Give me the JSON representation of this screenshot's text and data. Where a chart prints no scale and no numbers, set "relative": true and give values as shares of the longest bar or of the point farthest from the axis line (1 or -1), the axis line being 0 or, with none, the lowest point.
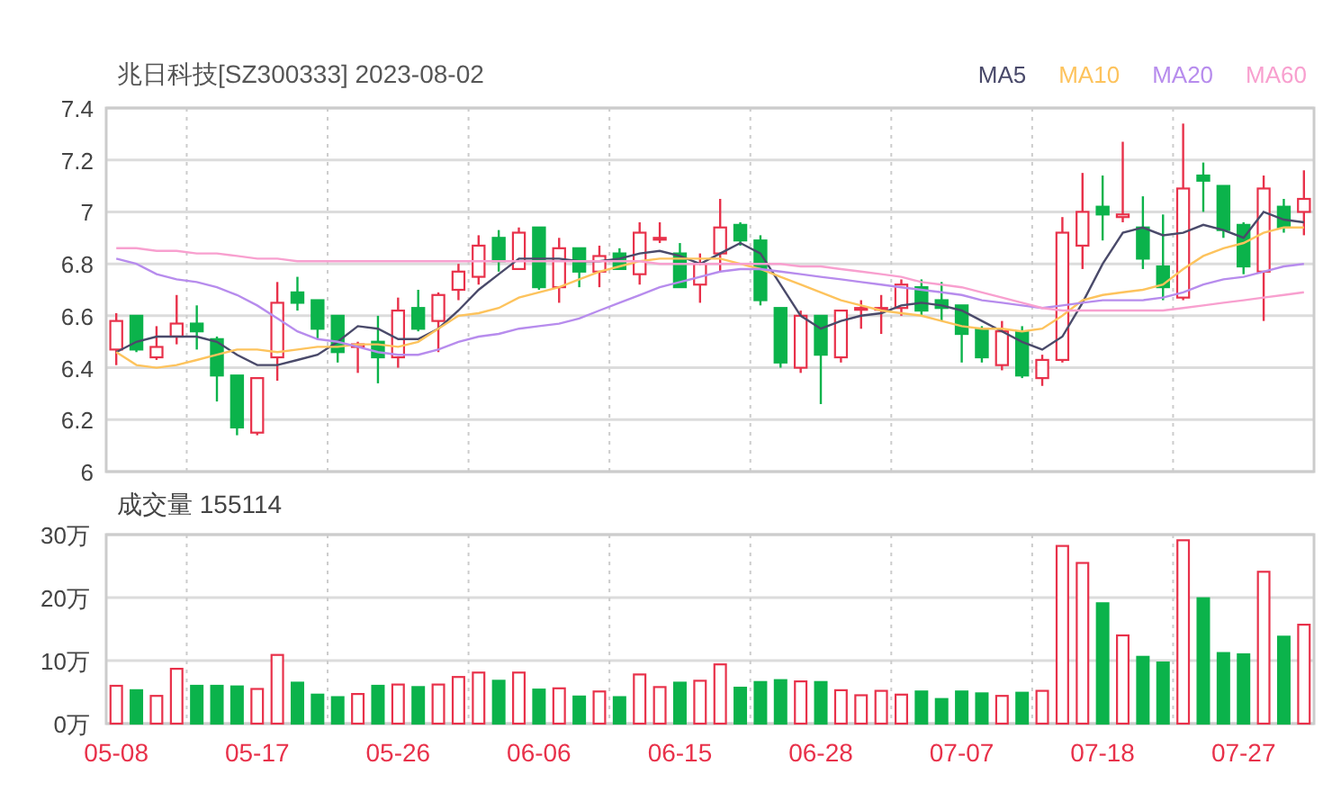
{
  "title": "兆日科技[SZ300333] 2023-08-02",
  "price_chart": {
    "chart_data": {
      "type": "candlestick",
      "grid": true,
      "ylim": [
        6,
        7.4
      ],
      "yticks": [
        6,
        6.2,
        6.4,
        6.6,
        6.8,
        7,
        7.2,
        7.4
      ],
      "ohlc": [
        [
          6.47,
          6.61,
          6.41,
          6.58
        ],
        [
          6.6,
          6.6,
          6.46,
          6.47
        ],
        [
          6.44,
          6.56,
          6.43,
          6.48
        ],
        [
          6.52,
          6.68,
          6.49,
          6.57
        ],
        [
          6.57,
          6.64,
          6.47,
          6.54
        ],
        [
          6.51,
          6.52,
          6.27,
          6.37
        ],
        [
          6.37,
          6.37,
          6.14,
          6.17
        ],
        [
          6.15,
          6.36,
          6.14,
          6.36
        ],
        [
          6.44,
          6.73,
          6.35,
          6.65
        ],
        [
          6.69,
          6.75,
          6.62,
          6.65
        ],
        [
          6.66,
          6.66,
          6.51,
          6.55
        ],
        [
          6.6,
          6.6,
          6.42,
          6.46
        ],
        [
          6.48,
          6.5,
          6.38,
          6.49
        ],
        [
          6.5,
          6.6,
          6.34,
          6.44
        ],
        [
          6.44,
          6.67,
          6.4,
          6.62
        ],
        [
          6.63,
          6.7,
          6.54,
          6.55
        ],
        [
          6.58,
          6.69,
          6.46,
          6.68
        ],
        [
          6.7,
          6.8,
          6.66,
          6.77
        ],
        [
          6.75,
          6.91,
          6.72,
          6.87
        ],
        [
          6.9,
          6.93,
          6.77,
          6.81
        ],
        [
          6.78,
          6.94,
          6.78,
          6.92
        ],
        [
          6.94,
          6.94,
          6.7,
          6.71
        ],
        [
          6.71,
          6.9,
          6.65,
          6.86
        ],
        [
          6.86,
          6.86,
          6.71,
          6.77
        ],
        [
          6.77,
          6.87,
          6.71,
          6.83
        ],
        [
          6.84,
          6.86,
          6.78,
          6.78
        ],
        [
          6.76,
          6.96,
          6.72,
          6.92
        ],
        [
          6.9,
          6.96,
          6.88,
          6.9
        ],
        [
          6.84,
          6.88,
          6.71,
          6.71
        ],
        [
          6.72,
          6.84,
          6.65,
          6.8
        ],
        [
          6.84,
          7.05,
          6.77,
          6.94
        ],
        [
          6.95,
          6.96,
          6.87,
          6.89
        ],
        [
          6.89,
          6.91,
          6.64,
          6.66
        ],
        [
          6.63,
          6.63,
          6.4,
          6.42
        ],
        [
          6.4,
          6.62,
          6.38,
          6.6
        ],
        [
          6.6,
          6.6,
          6.26,
          6.45
        ],
        [
          6.44,
          6.62,
          6.42,
          6.62
        ],
        [
          6.63,
          6.66,
          6.55,
          6.63
        ],
        [
          6.63,
          6.68,
          6.53,
          6.63
        ],
        [
          6.63,
          6.74,
          6.6,
          6.72
        ],
        [
          6.71,
          6.74,
          6.6,
          6.62
        ],
        [
          6.66,
          6.73,
          6.58,
          6.63
        ],
        [
          6.64,
          6.64,
          6.42,
          6.53
        ],
        [
          6.55,
          6.56,
          6.42,
          6.44
        ],
        [
          6.41,
          6.58,
          6.39,
          6.54
        ],
        [
          6.54,
          6.56,
          6.36,
          6.37
        ],
        [
          6.36,
          6.45,
          6.33,
          6.43
        ],
        [
          6.43,
          6.98,
          6.42,
          6.92
        ],
        [
          6.87,
          7.15,
          6.78,
          7.0
        ],
        [
          7.02,
          7.14,
          6.89,
          6.99
        ],
        [
          6.98,
          7.27,
          6.96,
          6.99
        ],
        [
          6.94,
          7.06,
          6.78,
          6.82
        ],
        [
          6.79,
          6.99,
          6.66,
          6.71
        ],
        [
          6.67,
          7.34,
          6.66,
          7.09
        ],
        [
          7.14,
          7.19,
          7.0,
          7.12
        ],
        [
          7.1,
          7.1,
          6.9,
          6.93
        ],
        [
          6.95,
          6.96,
          6.76,
          6.79
        ],
        [
          6.77,
          7.14,
          6.58,
          7.09
        ],
        [
          7.02,
          7.05,
          6.92,
          6.94
        ],
        [
          7.0,
          7.16,
          6.91,
          7.05
        ]
      ]
    },
    "moving_averages": {
      "chart_data": {
        "type": "line",
        "relative": true,
        "ylim": [
          6,
          7.4
        ],
        "series": [
          {
            "name": "MA5",
            "color": "#4a4a6a",
            "values": [
              6.46,
              6.5,
              6.52,
              6.52,
              6.52,
              6.5,
              6.45,
              6.41,
              6.41,
              6.43,
              6.45,
              6.5,
              6.56,
              6.55,
              6.51,
              6.51,
              6.55,
              6.62,
              6.7,
              6.76,
              6.82,
              6.82,
              6.82,
              6.81,
              6.81,
              6.82,
              6.84,
              6.85,
              6.83,
              6.8,
              6.84,
              6.88,
              6.84,
              6.72,
              6.6,
              6.55,
              6.58,
              6.6,
              6.61,
              6.64,
              6.65,
              6.64,
              6.62,
              6.58,
              6.54,
              6.5,
              6.47,
              6.52,
              6.65,
              6.8,
              6.92,
              6.94,
              6.91,
              6.92,
              6.95,
              6.93,
              6.9,
              7.0,
              6.97,
              6.96
            ]
          },
          {
            "name": "MA10",
            "color": "#fdc35d",
            "values": [
              6.46,
              6.41,
              6.4,
              6.41,
              6.43,
              6.45,
              6.47,
              6.47,
              6.46,
              6.47,
              6.48,
              6.48,
              6.49,
              6.49,
              6.48,
              6.5,
              6.55,
              6.6,
              6.61,
              6.63,
              6.67,
              6.69,
              6.71,
              6.74,
              6.77,
              6.79,
              6.81,
              6.82,
              6.82,
              6.82,
              6.82,
              6.8,
              6.78,
              6.75,
              6.72,
              6.69,
              6.66,
              6.64,
              6.62,
              6.61,
              6.6,
              6.58,
              6.56,
              6.55,
              6.55,
              6.54,
              6.55,
              6.6,
              6.66,
              6.68,
              6.69,
              6.7,
              6.72,
              6.78,
              6.83,
              6.86,
              6.88,
              6.92,
              6.94,
              6.94
            ]
          },
          {
            "name": "MA20",
            "color": "#b78ced",
            "values": [
              6.82,
              6.8,
              6.76,
              6.74,
              6.73,
              6.71,
              6.68,
              6.64,
              6.59,
              6.54,
              6.51,
              6.5,
              6.48,
              6.46,
              6.45,
              6.45,
              6.47,
              6.5,
              6.52,
              6.53,
              6.55,
              6.56,
              6.57,
              6.59,
              6.62,
              6.65,
              6.68,
              6.71,
              6.73,
              6.75,
              6.77,
              6.78,
              6.78,
              6.77,
              6.76,
              6.75,
              6.74,
              6.73,
              6.72,
              6.71,
              6.7,
              6.69,
              6.68,
              6.66,
              6.65,
              6.64,
              6.63,
              6.64,
              6.65,
              6.66,
              6.66,
              6.66,
              6.67,
              6.69,
              6.72,
              6.74,
              6.75,
              6.77,
              6.79,
              6.8
            ]
          },
          {
            "name": "MA60",
            "color": "#f8a0cf",
            "values": [
              6.86,
              6.86,
              6.85,
              6.85,
              6.84,
              6.84,
              6.83,
              6.82,
              6.82,
              6.81,
              6.81,
              6.81,
              6.81,
              6.81,
              6.81,
              6.81,
              6.81,
              6.81,
              6.81,
              6.81,
              6.81,
              6.81,
              6.81,
              6.81,
              6.81,
              6.81,
              6.81,
              6.8,
              6.8,
              6.8,
              6.8,
              6.8,
              6.8,
              6.8,
              6.79,
              6.79,
              6.78,
              6.77,
              6.76,
              6.75,
              6.73,
              6.72,
              6.71,
              6.69,
              6.67,
              6.65,
              6.63,
              6.62,
              6.62,
              6.62,
              6.62,
              6.62,
              6.62,
              6.63,
              6.64,
              6.65,
              6.66,
              6.67,
              6.68,
              6.69
            ]
          }
        ]
      }
    }
  },
  "volume_chart": {
    "title": "成交量 155114",
    "chart_data": {
      "type": "bar",
      "grid": true,
      "ylim": [
        0,
        30
      ],
      "yticks": [
        {
          "value": 0,
          "label": "0万"
        },
        {
          "value": 10,
          "label": "10万"
        },
        {
          "value": 20,
          "label": "20万"
        },
        {
          "value": 30,
          "label": "30万"
        }
      ],
      "categories": [
        "05-08",
        null,
        null,
        null,
        null,
        null,
        null,
        "05-17",
        null,
        null,
        null,
        null,
        null,
        null,
        "05-26",
        null,
        null,
        null,
        null,
        null,
        null,
        "06-06",
        null,
        null,
        null,
        null,
        null,
        null,
        "06-15",
        null,
        null,
        null,
        null,
        null,
        null,
        "06-28",
        null,
        null,
        null,
        null,
        null,
        null,
        "07-07",
        null,
        null,
        null,
        null,
        null,
        null,
        "07-18",
        null,
        null,
        null,
        null,
        null,
        null,
        "07-27",
        null,
        null,
        null
      ],
      "values": [
        6.0,
        5.3,
        4.4,
        8.7,
        6.0,
        6.0,
        5.9,
        5.5,
        10.9,
        6.5,
        4.6,
        4.2,
        4.7,
        6.0,
        6.2,
        5.8,
        6.2,
        7.4,
        8.1,
        6.8,
        8.1,
        5.4,
        5.6,
        4.3,
        5.1,
        4.2,
        7.8,
        5.8,
        6.5,
        6.8,
        9.4,
        5.7,
        6.6,
        6.9,
        6.7,
        6.6,
        5.3,
        4.5,
        5.2,
        4.6,
        5.1,
        3.9,
        5.1,
        4.8,
        4.4,
        4.9,
        5.2,
        28.2,
        25.5,
        19.1,
        14.0,
        10.6,
        9.7,
        29.1,
        19.9,
        11.2,
        11.0,
        24.1,
        13.8,
        15.7
      ]
    }
  }
}
